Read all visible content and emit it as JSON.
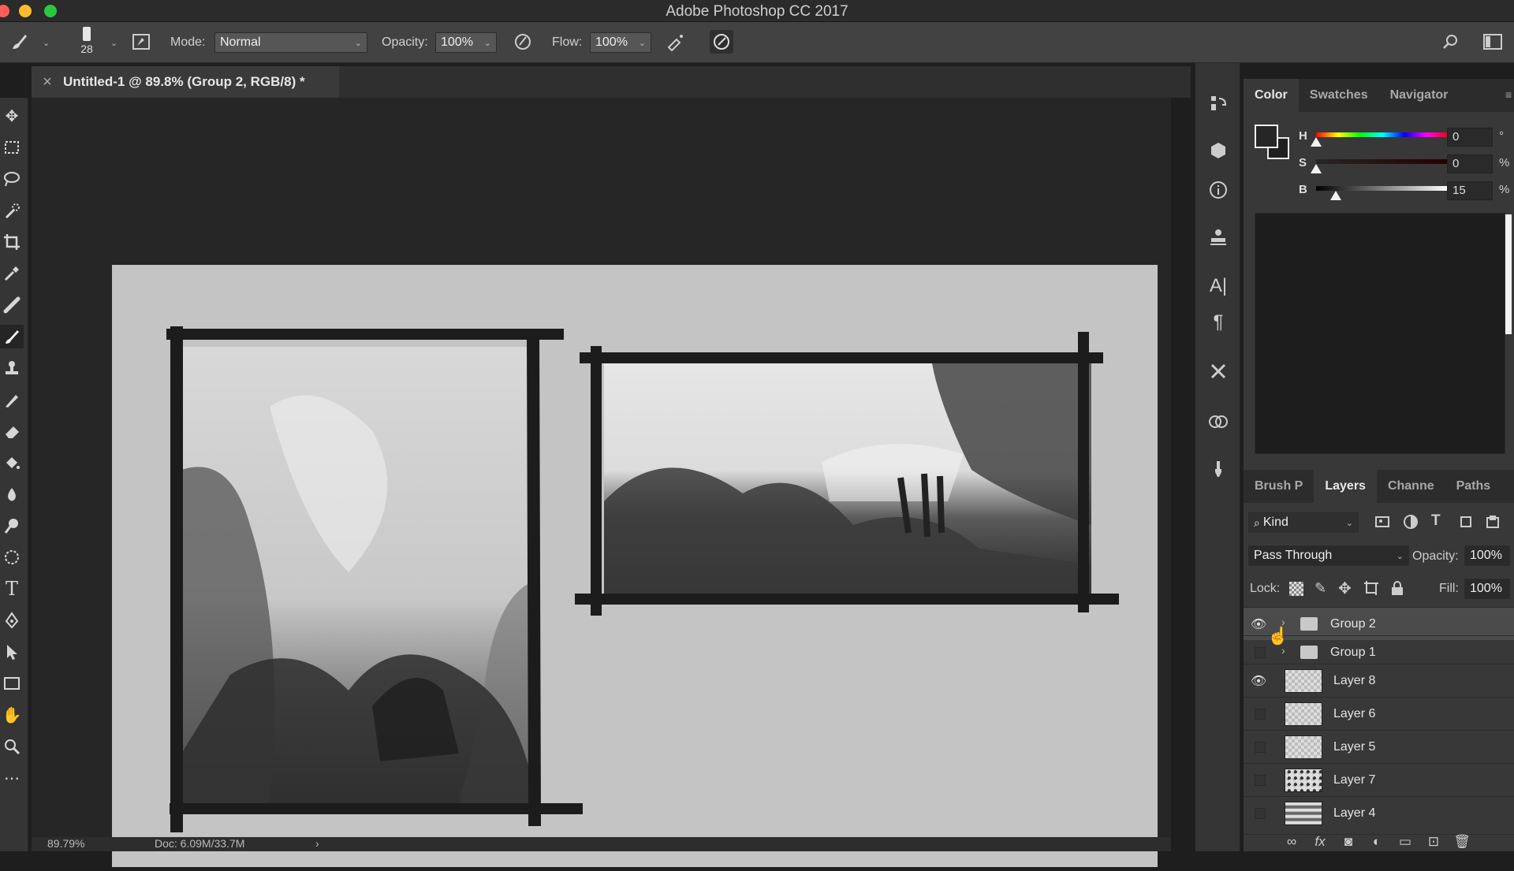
{
  "app_title": "Adobe Photoshop CC 2017",
  "colors": {
    "window_bg": "#1e1e1e",
    "panel_bg": "#383838",
    "canvas_doc": "#c4c4c4",
    "accent_white": "#ffffff"
  },
  "options_bar": {
    "brush_size": "28",
    "mode_label": "Mode:",
    "mode_value": "Normal",
    "opacity_label": "Opacity:",
    "opacity_value": "100%",
    "flow_label": "Flow:",
    "flow_value": "100%"
  },
  "document": {
    "tab_title": "Untitled-1 @ 89.8% (Group 2, RGB/8) *",
    "close_glyph": "×"
  },
  "status_bar": {
    "zoom": "89.79%",
    "doc_info": "Doc: 6.09M/33.7M",
    "arrow": "›"
  },
  "color_panel": {
    "tabs": [
      "Color",
      "Swatches",
      "Navigator"
    ],
    "active_tab": "Color",
    "h": {
      "label": "H",
      "value": "0",
      "unit": "°",
      "fraction": 0.0
    },
    "s": {
      "label": "S",
      "value": "0",
      "unit": "%",
      "fraction": 0.0
    },
    "b": {
      "label": "B",
      "value": "15",
      "unit": "%",
      "fraction": 0.15
    }
  },
  "layers_panel": {
    "tabs": [
      "Brush P",
      "Layers",
      "Channe",
      "Paths"
    ],
    "active_tab": "Layers",
    "filter_value": "Kind",
    "blend_mode": "Pass Through",
    "opacity_label": "Opacity:",
    "opacity_value": "100%",
    "lock_label": "Lock:",
    "fill_label": "Fill:",
    "fill_value": "100%",
    "layers": [
      {
        "name": "Group 2",
        "type": "group",
        "visible": true,
        "selected": true
      },
      {
        "name": "Group 1",
        "type": "group",
        "visible": false,
        "selected": false
      },
      {
        "name": "Layer 8",
        "type": "layer",
        "visible": true,
        "selected": false
      },
      {
        "name": "Layer 6",
        "type": "layer",
        "visible": false,
        "selected": false
      },
      {
        "name": "Layer 5",
        "type": "layer",
        "visible": false,
        "selected": false
      },
      {
        "name": "Layer 7",
        "type": "layer",
        "visible": false,
        "selected": false
      },
      {
        "name": "Layer 4",
        "type": "layer",
        "visible": false,
        "selected": false
      }
    ]
  },
  "icons": {
    "tools": [
      "move-icon",
      "marquee-icon",
      "lasso-icon",
      "quick-select-icon",
      "crop-icon",
      "eyedropper-icon",
      "brush-icon",
      "pencil-icon",
      "mixer-brush-icon",
      "history-brush-icon",
      "stamp-icon",
      "healing-icon",
      "eraser-icon",
      "paint-bucket-icon",
      "blur-icon",
      "dodge-icon",
      "sponge-icon",
      "type-icon",
      "pen-icon",
      "path-select-icon",
      "rectangle-icon",
      "hand-icon",
      "zoom-icon",
      "more-icon"
    ],
    "dock": [
      "history-icon",
      "3d-icon",
      "info-icon",
      "clone-source-icon",
      "character-icon",
      "paragraph-icon",
      "tool-presets-icon",
      "libraries-icon",
      "brush-presets-icon"
    ]
  }
}
